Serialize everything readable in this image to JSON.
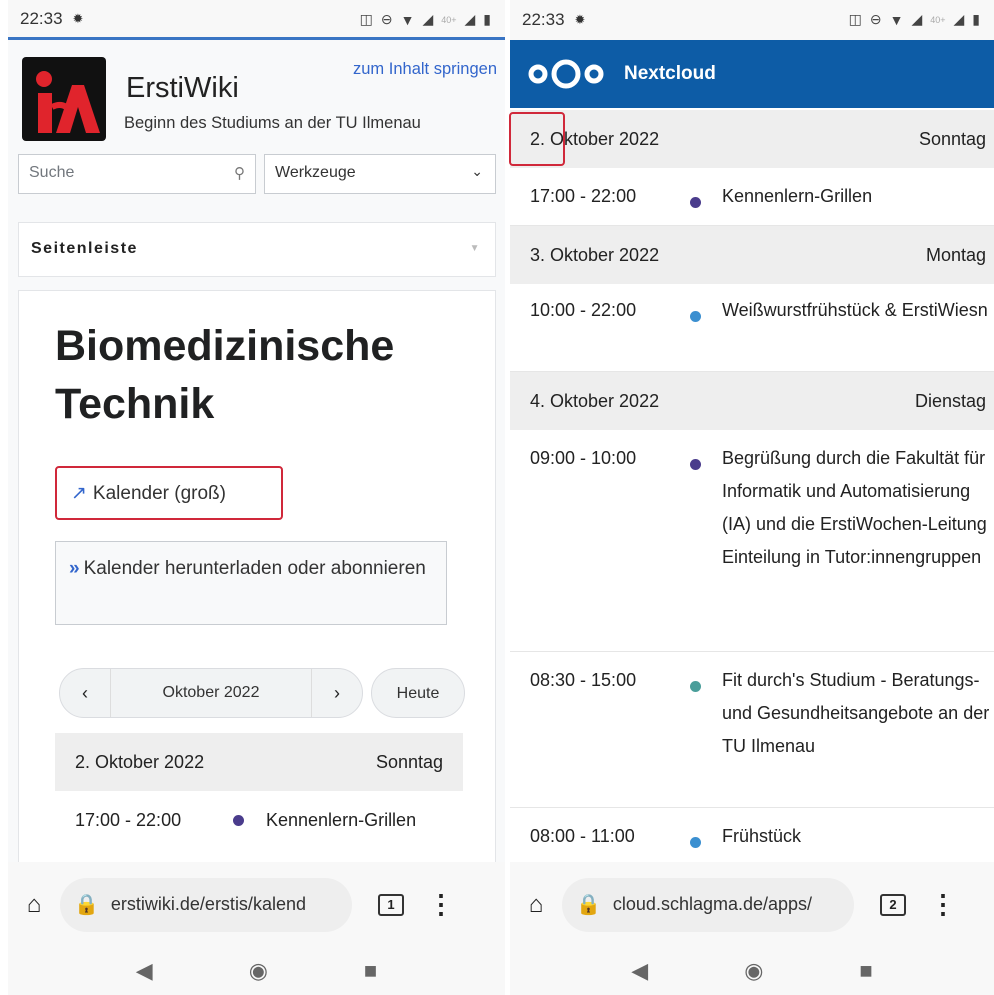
{
  "left": {
    "status": {
      "time": "22:33",
      "data_label": "40+"
    },
    "wiki": {
      "title": "ErstiWiki",
      "subtitle": "Beginn des Studiums an der TU Ilmenau",
      "skip_link": "zum Inhalt springen"
    },
    "search": {
      "placeholder": "Suche"
    },
    "tools": {
      "label": "Werkzeuge"
    },
    "sidebar": {
      "label": "Seitenleiste"
    },
    "page": {
      "title": "Biomedizinische Technik"
    },
    "calendar_link": {
      "label": "Kalender (groß)"
    },
    "download_box": {
      "label": "Kalender herunterladen oder abonnieren"
    },
    "calendar_nav": {
      "month": "Oktober 2022",
      "prev": "‹",
      "next": "›",
      "today": "Heute"
    },
    "day": {
      "date": "2. Oktober 2022",
      "weekday": "Sonntag"
    },
    "event": {
      "time": "17:00 - 22:00",
      "title": "Kennenlern-Grillen",
      "color": "#4a3c8c"
    },
    "browser": {
      "url": "erstiwiki.de/erstis/kalend",
      "tab_count": "1"
    }
  },
  "right": {
    "status": {
      "time": "22:33",
      "data_label": "40+"
    },
    "app": {
      "name": "Nextcloud",
      "brand_color": "#0d5ca6"
    },
    "days": [
      {
        "date": "2. Oktober 2022",
        "weekday": "Sonntag",
        "events": [
          {
            "time": "17:00 - 22:00",
            "title": "Kennenlern-Grillen",
            "color": "#4a3c8c"
          }
        ]
      },
      {
        "date": "3. Oktober 2022",
        "weekday": "Montag",
        "events": [
          {
            "time": "10:00 - 22:00",
            "title": "Weißwurstfrühstück & ErstiWiesn",
            "color": "#3b8fd0"
          }
        ]
      },
      {
        "date": "4. Oktober 2022",
        "weekday": "Dienstag",
        "events": [
          {
            "time": "09:00 - 10:00",
            "title": "Begrüßung durch die Fakultät für Informatik und Automatisierung (IA) und die ErstiWochen-Leitung Einteilung in Tutor:innengruppen",
            "color": "#4a3c8c"
          },
          {
            "time": "08:30 - 15:00",
            "title": "Fit durch's Studium - Beratungs- und Gesundheitsangebote an der TU Ilmenau",
            "color": "#4a9e9a"
          },
          {
            "time": "08:00 - 11:00",
            "title": "Frühstück",
            "color": "#3b8fd0"
          }
        ]
      }
    ],
    "browser": {
      "url": "cloud.schlagma.de/apps/",
      "tab_count": "2"
    }
  }
}
